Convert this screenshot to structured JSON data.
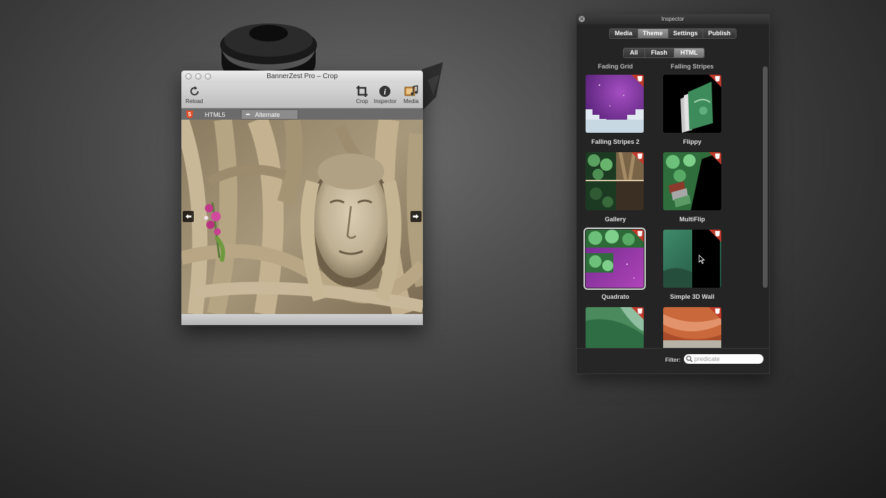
{
  "bz_window": {
    "title": "BannerZest Pro – Crop",
    "toolbar": {
      "reload": "Reload",
      "crop": "Crop",
      "inspector": "Inspector",
      "media": "Media"
    },
    "tabs": {
      "html5": "HTML5",
      "alternate": "Alternate"
    }
  },
  "inspector": {
    "title": "Inspector",
    "top_tabs": [
      "Media",
      "Theme",
      "Settings",
      "Publish"
    ],
    "active_top_tab": "Theme",
    "sub_tabs": [
      "All",
      "Flash",
      "HTML"
    ],
    "active_sub_tab": "HTML",
    "cut_labels": [
      "Fading Grid",
      "Falling Stripes"
    ],
    "themes": [
      {
        "name": "Falling Stripes 2",
        "selected": false
      },
      {
        "name": "Flippy",
        "selected": false
      },
      {
        "name": "Gallery",
        "selected": false
      },
      {
        "name": "MultiFlip",
        "selected": false
      },
      {
        "name": "Quadrato",
        "selected": true
      },
      {
        "name": "Simple 3D Wall",
        "selected": false
      }
    ],
    "filter": {
      "label": "Filter:",
      "placeholder": "predicate"
    }
  },
  "colors": {
    "html5_badge": "#e34c26",
    "panel_bg": "#242424"
  }
}
